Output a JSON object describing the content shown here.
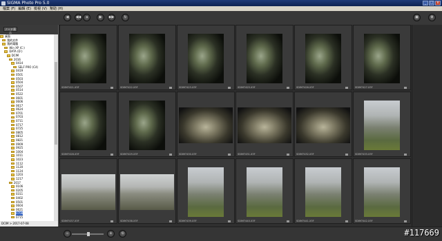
{
  "window": {
    "title": "SIGMA Photo Pro 5.0"
  },
  "menu": [
    "檔案 (F)",
    "編輯 (E)",
    "檢視 (V)",
    "幫助 (H)"
  ],
  "toolbar": {
    "left_buttons": [
      "◀",
      "◀◀",
      "▶",
      "▶▶",
      "↻"
    ]
  },
  "sidebar": {
    "head_chip": "ノード表示",
    "status": "DCIM > 2017-07-08",
    "tree": [
      {
        "label": "桌面",
        "indent": 0
      },
      {
        "label": "我的文件",
        "indent": 2
      },
      {
        "label": "我的電腦",
        "indent": 2
      },
      {
        "label": "Win XP (C:)",
        "indent": 4
      },
      {
        "label": "DATA (D:)",
        "indent": 4
      },
      {
        "label": "DCIM",
        "indent": 6
      },
      {
        "label": "2016",
        "indent": 8
      },
      {
        "label": "0414",
        "indent": 10
      },
      {
        "label": "SELF PRO (C4)",
        "indent": 12
      },
      {
        "label": "0419",
        "indent": 10
      },
      {
        "label": "0501",
        "indent": 10
      },
      {
        "label": "0503",
        "indent": 10
      },
      {
        "label": "0504",
        "indent": 10
      },
      {
        "label": "0507",
        "indent": 10
      },
      {
        "label": "0514",
        "indent": 10
      },
      {
        "label": "0522",
        "indent": 10
      },
      {
        "label": "0601",
        "indent": 10
      },
      {
        "label": "0606",
        "indent": 10
      },
      {
        "label": "0617",
        "indent": 10
      },
      {
        "label": "0624",
        "indent": 10
      },
      {
        "label": "0701",
        "indent": 10
      },
      {
        "label": "0703",
        "indent": 10
      },
      {
        "label": "0711",
        "indent": 10
      },
      {
        "label": "0717",
        "indent": 10
      },
      {
        "label": "0725",
        "indent": 10
      },
      {
        "label": "0805",
        "indent": 10
      },
      {
        "label": "0812",
        "indent": 10
      },
      {
        "label": "0821",
        "indent": 10
      },
      {
        "label": "0909",
        "indent": 10
      },
      {
        "label": "0925",
        "indent": 10
      },
      {
        "label": "1004",
        "indent": 10
      },
      {
        "label": "1011",
        "indent": 10
      },
      {
        "label": "1023",
        "indent": 10
      },
      {
        "label": "1112",
        "indent": 10
      },
      {
        "label": "1120",
        "indent": 10
      },
      {
        "label": "1124",
        "indent": 10
      },
      {
        "label": "1203",
        "indent": 10
      },
      {
        "label": "1217",
        "indent": 10
      },
      {
        "label": "2017",
        "indent": 8
      },
      {
        "label": "0106",
        "indent": 10
      },
      {
        "label": "0205",
        "indent": 10
      },
      {
        "label": "0311",
        "indent": 10
      },
      {
        "label": "0402",
        "indent": 10
      },
      {
        "label": "0501",
        "indent": 10
      },
      {
        "label": "0604",
        "indent": 10
      },
      {
        "label": "0621",
        "indent": 10
      },
      {
        "label": "0708",
        "indent": 10,
        "selected": true
      },
      {
        "label": "0715",
        "indent": 10
      }
    ]
  },
  "thumbnails": [
    {
      "name": "SDIM7421.X3F",
      "style": "dark-rock"
    },
    {
      "name": "SDIM7422.X3F",
      "style": "dark-rock"
    },
    {
      "name": "SDIM7423.X3F",
      "style": "dark-rock"
    },
    {
      "name": "SDIM7425.X3F",
      "style": "dark-rock"
    },
    {
      "name": "SDIM7426.X3F",
      "style": "dark-rock"
    },
    {
      "name": "SDIM7427.X3F",
      "style": "dark-rock"
    },
    {
      "name": "SDIM7428.X3F",
      "style": "dark-rock"
    },
    {
      "name": "SDIM7429.X3F",
      "style": "dark-rock"
    },
    {
      "name": "SDIM7430.X3F",
      "style": "rock-land"
    },
    {
      "name": "SDIM7431.X3F",
      "style": "rock-land"
    },
    {
      "name": "SDIM7432.X3F",
      "style": "rock-land"
    },
    {
      "name": "SDIM7433.X3F",
      "style": "city-port"
    },
    {
      "name": "SDIM7437.X3F",
      "style": "city-land"
    },
    {
      "name": "SDIM7438.X3F",
      "style": "city-land"
    },
    {
      "name": "SDIM7439.X3F",
      "style": "city-port"
    },
    {
      "name": "SDIM7440.X3F",
      "style": "city-port"
    },
    {
      "name": "SDIM7441.X3F",
      "style": "city-port"
    },
    {
      "name": "SDIM7442.X3F",
      "style": "city-port"
    }
  ],
  "watermark": "#117669"
}
